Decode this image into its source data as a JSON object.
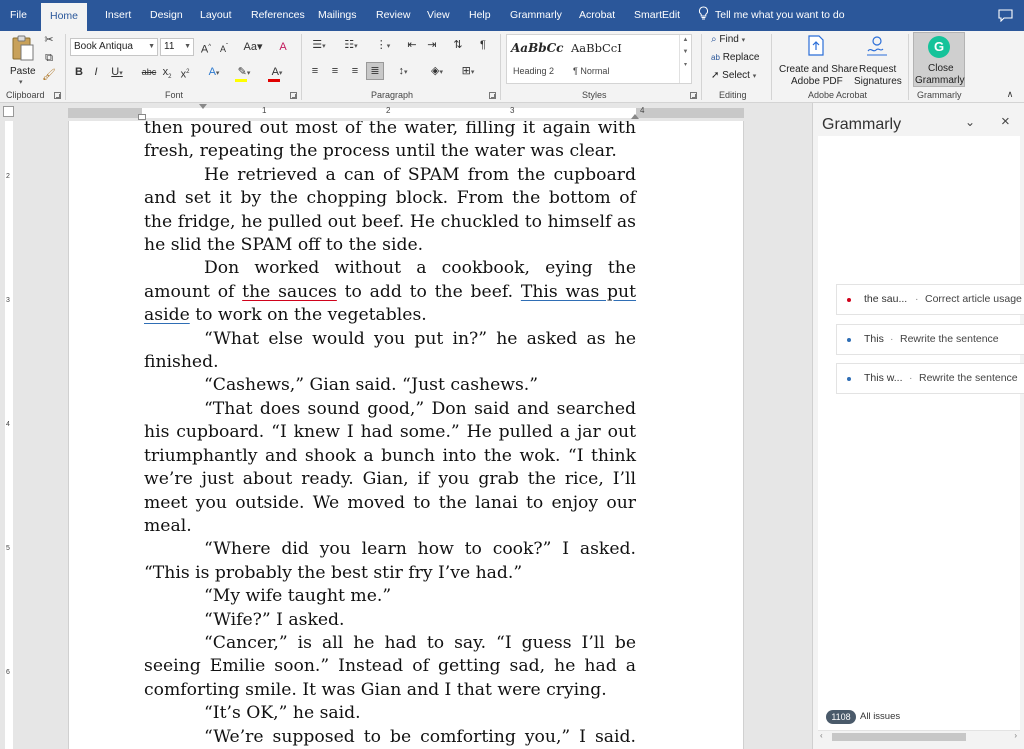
{
  "tabs": {
    "items": [
      "File",
      "Home",
      "Insert",
      "Design",
      "Layout",
      "References",
      "Mailings",
      "Review",
      "View",
      "Help",
      "Grammarly",
      "Acrobat",
      "SmartEdit"
    ],
    "active": "Home",
    "tell_me": "Tell me what you want to do"
  },
  "ribbon": {
    "clipboard": {
      "paste": "Paste",
      "label": "Clipboard"
    },
    "font": {
      "name": "Book Antiqua",
      "size": "11",
      "label": "Font"
    },
    "paragraph": {
      "label": "Paragraph"
    },
    "styles": {
      "label": "Styles",
      "items": [
        {
          "sample": "AaBbCc",
          "name": "Heading 2"
        },
        {
          "sample": "AaBbCcI",
          "name": "¶ Normal"
        }
      ]
    },
    "editing": {
      "find": "Find",
      "replace": "Replace",
      "select": "Select",
      "label": "Editing"
    },
    "acrobat": {
      "create": "Create and Share",
      "create2": "Adobe PDF",
      "request": "Request",
      "request2": "Signatures",
      "label": "Adobe Acrobat"
    },
    "grammarly": {
      "close": "Close",
      "close2": "Grammarly",
      "label": "Grammarly"
    }
  },
  "rulers": {
    "h_numbers": [
      "1",
      "2",
      "3",
      "4"
    ],
    "v_numbers": [
      "2",
      "3",
      "4",
      "5",
      "6"
    ]
  },
  "document": {
    "paragraphs": [
      {
        "indent": false,
        "segments": [
          {
            "t": "then poured out most of the water, filling it again with fresh, repeating the process until the water was clear."
          }
        ]
      },
      {
        "indent": true,
        "segments": [
          {
            "t": "He retrieved a can of SPAM from the cupboard and set it by the chopping block. From the bottom of the fridge, he pulled out beef. He chuckled to himself as he slid the SPAM off to the side."
          }
        ]
      },
      {
        "indent": true,
        "segments": [
          {
            "t": "Don worked without a cookbook, eying the amount of "
          },
          {
            "t": "the sauces",
            "mark": "red"
          },
          {
            "t": " to add to the beef. "
          },
          {
            "t": "This was put aside",
            "mark": "blue"
          },
          {
            "t": " to work on the vegetables."
          }
        ]
      },
      {
        "indent": true,
        "segments": [
          {
            "t": "“What else would you put in?” he asked as he finished."
          }
        ]
      },
      {
        "indent": true,
        "segments": [
          {
            "t": "“Cashews,” Gian said. “Just cashews.”"
          }
        ]
      },
      {
        "indent": true,
        "segments": [
          {
            "t": "“That does sound good,” Don said and searched his cupboard. “I knew I had some.” He pulled a jar out triumphantly and shook a bunch into the wok. “I think we’re just about ready. Gian, if you grab the rice, I’ll meet you outside. We moved to the lanai to enjoy our meal."
          }
        ]
      },
      {
        "indent": true,
        "segments": [
          {
            "t": "“Where did you learn how to cook?” I asked. “This is probably the best stir fry I’ve had.”"
          }
        ]
      },
      {
        "indent": true,
        "segments": [
          {
            "t": "“My wife taught me.”"
          }
        ]
      },
      {
        "indent": true,
        "segments": [
          {
            "t": "“Wife?” I asked."
          }
        ]
      },
      {
        "indent": true,
        "segments": [
          {
            "t": "“Cancer,” is all he had to say. “I guess I’ll be seeing Emilie soon.” Instead of getting sad, he had a comforting smile. It was Gian and I that were crying."
          }
        ]
      },
      {
        "indent": true,
        "segments": [
          {
            "t": "“It’s OK,” he said."
          }
        ]
      },
      {
        "indent": true,
        "segments": [
          {
            "t": "“We’re supposed to be comforting you,” I said. “Not the other way around.”"
          }
        ]
      }
    ]
  },
  "grammarly_pane": {
    "title": "Grammarly",
    "cards": [
      {
        "snippet": "the sau...",
        "action": "Correct article usage",
        "color": "#d0021b"
      },
      {
        "snippet": "This",
        "action": "Rewrite the sentence",
        "color": "#2f6eb5"
      },
      {
        "snippet": "This w...",
        "action": "Rewrite the sentence",
        "color": "#2f6eb5"
      }
    ],
    "issues_count": "1108",
    "issues_label": "All issues"
  },
  "colors": {
    "titlebar": "#2b579a",
    "ribbon": "#f3f3f3",
    "grammarly_green": "#15c39a",
    "error_red": "#d0021b",
    "clarity_blue": "#2f6eb5"
  }
}
